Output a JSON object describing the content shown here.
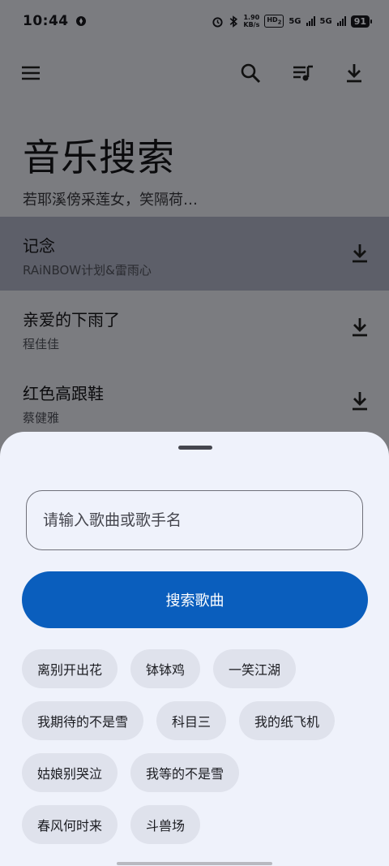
{
  "status": {
    "time": "10:44",
    "net_speed_value": "1.90",
    "net_speed_unit": "KB/s",
    "hd_label": "HD",
    "hd_sub": "2",
    "sim1_label": "5G",
    "sim2_label": "5G",
    "battery": "91",
    "icons": [
      "alarm-icon",
      "bluetooth-icon"
    ]
  },
  "appbar": {
    "icons": [
      "menu-icon",
      "search-icon",
      "playlist-icon",
      "download-icon"
    ]
  },
  "header": {
    "title": "音乐搜索",
    "subtitle": "若耶溪傍采莲女，笑隔荷…"
  },
  "songs": [
    {
      "name": "记念",
      "artist": "RAiNBOW计划&雷雨心",
      "selected": true
    },
    {
      "name": "亲爱的下雨了",
      "artist": "程佳佳",
      "selected": false
    },
    {
      "name": "红色高跟鞋",
      "artist": "蔡健雅",
      "selected": false
    }
  ],
  "sheet": {
    "search_placeholder": "请输入歌曲或歌手名",
    "search_button": "搜索歌曲",
    "suggestions": [
      [
        "离别开出花",
        "钵钵鸡",
        "一笑江湖"
      ],
      [
        "我期待的不是雪",
        "科目三",
        "我的纸飞机"
      ],
      [
        "姑娘别哭泣",
        "我等的不是雪"
      ],
      [
        "春风何时来",
        "斗兽场"
      ]
    ]
  },
  "colors": {
    "scrim": "#7b7c80",
    "selected_row": "#5d5f69",
    "sheet_bg": "#eff2fb",
    "primary": "#0a5ebd",
    "chip_bg": "#dfe2ec"
  }
}
